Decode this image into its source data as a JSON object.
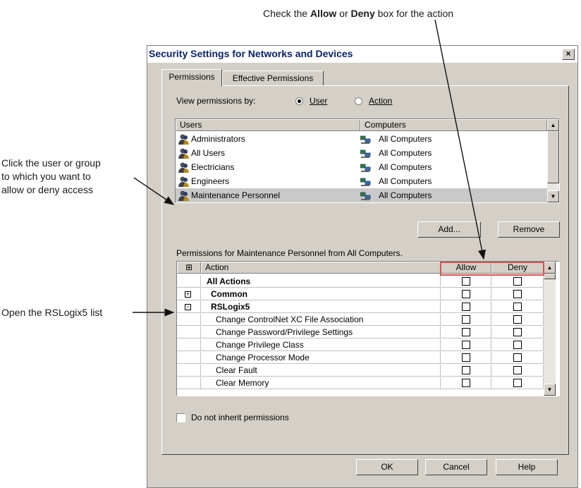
{
  "annotations": {
    "top_prefix": "Check the ",
    "top_allow": "Allow",
    "top_or": " or ",
    "top_deny": "Deny",
    "top_suffix": " box for the action",
    "left_user_lines": [
      "Click the user or group",
      "to which you want to",
      "allow or deny access"
    ],
    "left_open": "Open the RSLogix5 list"
  },
  "dialog": {
    "title": "Security Settings for Networks and Devices",
    "close_glyph": "×",
    "tabs": [
      "Permissions",
      "Effective Permissions"
    ],
    "view_by_label": "View permissions by:",
    "radio_user": "User",
    "radio_action": "Action",
    "radio_selected": "User",
    "users_header": "Users",
    "computers_header": "Computers",
    "users": [
      {
        "name": "Administrators",
        "computer": "All Computers"
      },
      {
        "name": "All Users",
        "computer": "All Computers"
      },
      {
        "name": "Electricians",
        "computer": "All Computers"
      },
      {
        "name": "Engineers",
        "computer": "All Computers"
      },
      {
        "name": "Maintenance Personnel",
        "computer": "All Computers",
        "selected": true
      }
    ],
    "add_button": "Add...",
    "remove_button": "Remove",
    "permissions_caption": "Permissions for Maintenance Personnel from All Computers.",
    "grid_header": {
      "expand": "⊞",
      "action": "Action",
      "allow": "Allow",
      "deny": "Deny"
    },
    "actions": [
      {
        "expander": "",
        "label": "All Actions",
        "bold": true,
        "level": 0
      },
      {
        "expander": "+",
        "label": "Common",
        "bold": true,
        "level": 1
      },
      {
        "expander": "−",
        "label": "RSLogix5",
        "bold": true,
        "level": 1
      },
      {
        "expander": "",
        "label": "Change ControlNet XC File Association",
        "bold": false,
        "level": 2
      },
      {
        "expander": "",
        "label": "Change Password/Privilege Settings",
        "bold": false,
        "level": 2
      },
      {
        "expander": "",
        "label": "Change Privilege Class",
        "bold": false,
        "level": 2
      },
      {
        "expander": "",
        "label": "Change Processor Mode",
        "bold": false,
        "level": 2
      },
      {
        "expander": "",
        "label": "Clear Fault",
        "bold": false,
        "level": 2
      },
      {
        "expander": "",
        "label": "Clear Memory",
        "bold": false,
        "level": 2
      }
    ],
    "inherit_label": "Do not inherit permissions",
    "ok_button": "OK",
    "cancel_button": "Cancel",
    "help_button": "Help"
  },
  "colors": {
    "title_text": "#0a246a",
    "highlight_box": "#d9534f",
    "selected_row": "#c9c9c9"
  }
}
